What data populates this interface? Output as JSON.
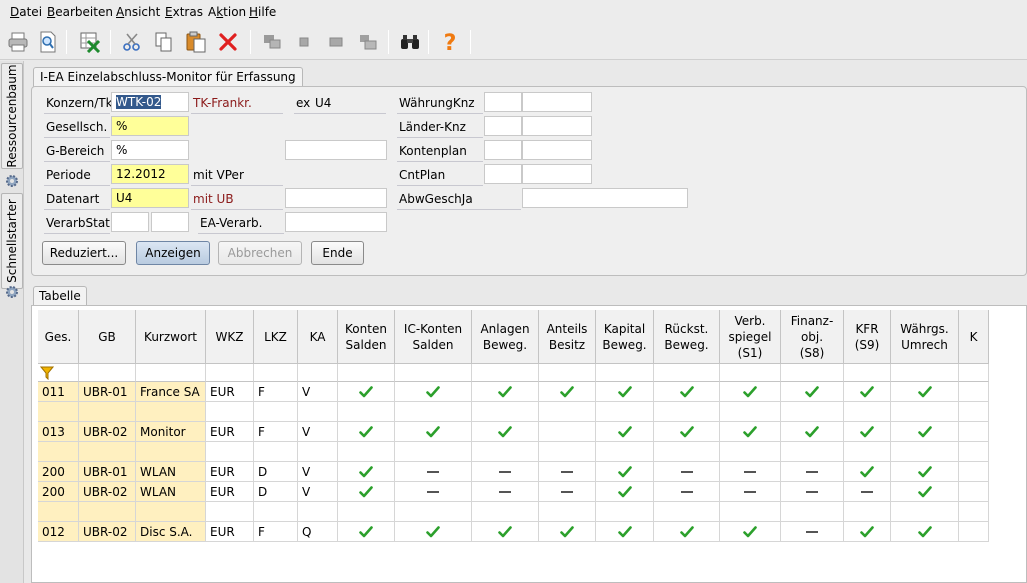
{
  "menu": [
    "Datei",
    "Bearbeiten",
    "Ansicht",
    "Extras",
    "Aktion",
    "Hilfe"
  ],
  "menu_mnemonics": [
    "D",
    "B",
    "A",
    "E",
    "k",
    "H"
  ],
  "toolbar_icons": [
    "print-icon",
    "preview-icon",
    "export-excel-icon",
    "cut-icon",
    "copy-icon",
    "paste-icon",
    "delete-icon",
    "window-cascade-icon",
    "window-small-icon",
    "window-medium-icon",
    "window-tile-icon",
    "binoculars-icon",
    "help-icon"
  ],
  "side_tabs": [
    "Ressourcenbaum",
    "Schnellstarter"
  ],
  "form": {
    "tab_title": "I-EA Einzelabschluss-Monitor für Erfassung",
    "konzern_label": "Konzern/Tk",
    "konzern_value": "WTK-02",
    "konzern_desc": "TK-Frankr.",
    "ex_label": "ex",
    "ex_value": "U4",
    "gesellsch_label": "Gesellsch.",
    "gesellsch_value": "%",
    "gbereich_label": "G-Bereich",
    "gbereich_value": "%",
    "periode_label": "Periode",
    "periode_value": "12.2012",
    "periode_desc": "mit VPer",
    "datenart_label": "Datenart",
    "datenart_value": "U4",
    "datenart_desc": "mit UB",
    "verarbstat_label": "VerarbStat",
    "eaverarb_label": "EA-Verarb.",
    "waehrung_label": "WährungKnz",
    "laender_label": "Länder-Knz",
    "kontenplan_label": "Kontenplan",
    "cntplan_label": "CntPlan",
    "abwgeschja_label": "AbwGeschJa"
  },
  "buttons": {
    "reduziert": "Reduziert...",
    "anzeigen": "Anzeigen",
    "abbrechen": "Abbrechen",
    "ende": "Ende"
  },
  "table": {
    "tab_title": "Tabelle",
    "columns": [
      {
        "label": "Ges.",
        "w": 41
      },
      {
        "label": "GB",
        "w": 57
      },
      {
        "label": "Kurzwort",
        "w": 70
      },
      {
        "label": "WKZ",
        "w": 48
      },
      {
        "label": "LKZ",
        "w": 44
      },
      {
        "label": "KA",
        "w": 40
      },
      {
        "label": "Konten\nSalden",
        "w": 57
      },
      {
        "label": "IC-Konten\nSalden",
        "w": 77
      },
      {
        "label": "Anlagen\nBeweg.",
        "w": 67
      },
      {
        "label": "Anteils\nBesitz",
        "w": 57
      },
      {
        "label": "Kapital\nBeweg.",
        "w": 58
      },
      {
        "label": "Rückst.\nBeweg.",
        "w": 66
      },
      {
        "label": "Verb.\nspiegel\n(S1)",
        "w": 61
      },
      {
        "label": "Finanz-\nobj.\n(S8)",
        "w": 63
      },
      {
        "label": "KFR\n(S9)",
        "w": 47
      },
      {
        "label": "Währgs.\nUmrech",
        "w": 68
      },
      {
        "label": "K",
        "w": 30
      }
    ],
    "rows": [
      {
        "ges": "011",
        "gb": "UBR-01",
        "kurzwort": "France SA",
        "wkz": "EUR",
        "lkz": "F",
        "ka": "V",
        "marks": [
          "check",
          "check",
          "check",
          "check",
          "check",
          "check",
          "check",
          "check",
          "check",
          "check",
          ""
        ]
      },
      {
        "ges": "",
        "gb": "",
        "kurzwort": "",
        "wkz": "",
        "lkz": "",
        "ka": "",
        "marks": [
          "",
          "",
          "",
          "",
          "",
          "",
          "",
          "",
          "",
          "",
          ""
        ]
      },
      {
        "ges": "013",
        "gb": "UBR-02",
        "kurzwort": "Monitor",
        "wkz": "EUR",
        "lkz": "F",
        "ka": "V",
        "marks": [
          "check",
          "check",
          "check",
          "",
          "check",
          "check",
          "check",
          "check",
          "check",
          "check",
          ""
        ]
      },
      {
        "ges": "",
        "gb": "",
        "kurzwort": "",
        "wkz": "",
        "lkz": "",
        "ka": "",
        "marks": [
          "",
          "",
          "",
          "",
          "",
          "",
          "",
          "",
          "",
          "",
          ""
        ]
      },
      {
        "ges": "200",
        "gb": "UBR-01",
        "kurzwort": "WLAN",
        "wkz": "EUR",
        "lkz": "D",
        "ka": "V",
        "marks": [
          "check",
          "dash",
          "dash",
          "dash",
          "check",
          "dash",
          "dash",
          "dash",
          "check",
          "check",
          ""
        ]
      },
      {
        "ges": "200",
        "gb": "UBR-02",
        "kurzwort": "WLAN",
        "wkz": "EUR",
        "lkz": "D",
        "ka": "V",
        "marks": [
          "check",
          "dash",
          "dash",
          "dash",
          "check",
          "dash",
          "dash",
          "dash",
          "dash",
          "check",
          ""
        ]
      },
      {
        "ges": "",
        "gb": "",
        "kurzwort": "",
        "wkz": "",
        "lkz": "",
        "ka": "",
        "marks": [
          "",
          "",
          "",
          "",
          "",
          "",
          "",
          "",
          "",
          "",
          ""
        ]
      },
      {
        "ges": "012",
        "gb": "UBR-02",
        "kurzwort": "Disc S.A.",
        "wkz": "EUR",
        "lkz": "F",
        "ka": "Q",
        "marks": [
          "check",
          "check",
          "check",
          "check",
          "check",
          "check",
          "check",
          "dash",
          "check",
          "check",
          ""
        ]
      }
    ]
  },
  "colors": {
    "highlight_yellow": "#ffff99",
    "frozen_column": "#fff0c0",
    "check_green": "#2ca02c",
    "label_red": "#8b1a1a",
    "selection_blue": "#33598c"
  }
}
